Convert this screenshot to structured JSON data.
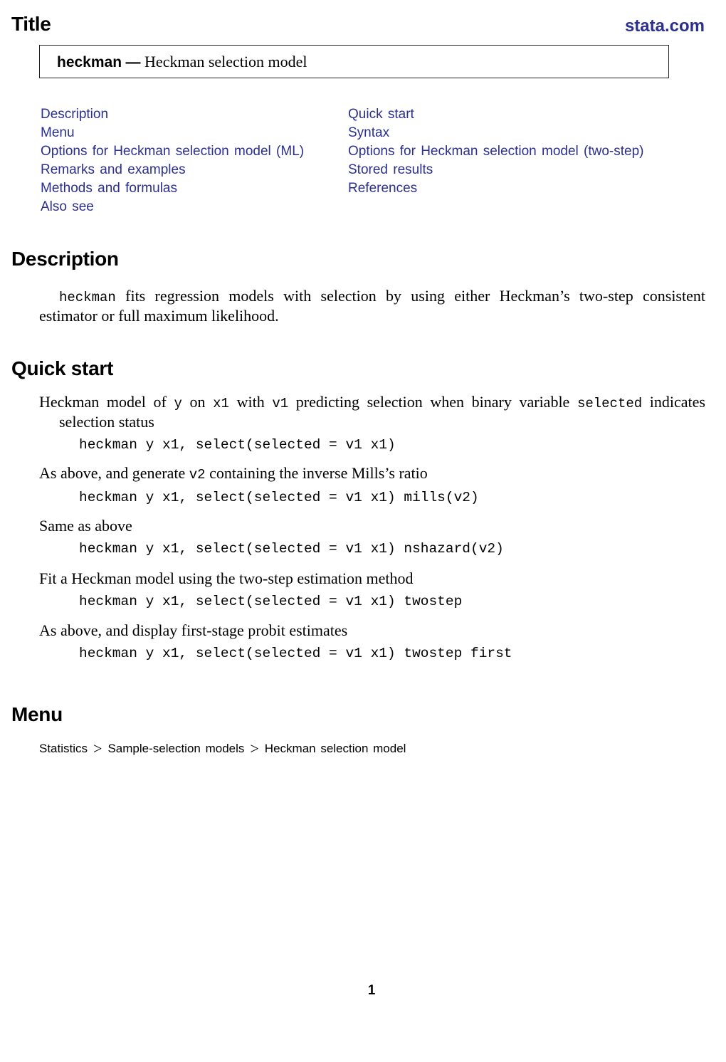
{
  "header": {
    "section_title": "Title",
    "brand_link": "stata.com"
  },
  "title_box": {
    "command": "heckman",
    "dash": "—",
    "description": "Heckman selection model"
  },
  "toc": {
    "left": [
      "Description",
      "Menu",
      "Options for Heckman selection model (ML)",
      "Remarks and examples",
      "Methods and formulas",
      "Also see"
    ],
    "right": [
      "Quick start",
      "Syntax",
      "Options for Heckman selection model (two-step)",
      "Stored results",
      "References"
    ]
  },
  "description": {
    "heading": "Description",
    "command": "heckman",
    "text": " fits regression models with selection by using either Heckman’s two-step consistent estimator or full maximum likelihood."
  },
  "quick_start": {
    "heading": "Quick start",
    "items": [
      {
        "desc_parts": [
          {
            "t": "Heckman model of ",
            "m": false
          },
          {
            "t": "y",
            "m": true
          },
          {
            "t": " on ",
            "m": false
          },
          {
            "t": "x1",
            "m": true
          },
          {
            "t": " with ",
            "m": false
          },
          {
            "t": "v1",
            "m": true
          },
          {
            "t": " predicting selection when binary variable ",
            "m": false
          },
          {
            "t": "selected",
            "m": true
          },
          {
            "t": " indicates selection status",
            "m": false
          }
        ],
        "command": "heckman y x1, select(selected = v1 x1)"
      },
      {
        "desc_parts": [
          {
            "t": "As above, and generate ",
            "m": false
          },
          {
            "t": "v2",
            "m": true
          },
          {
            "t": " containing the inverse Mills’s ratio",
            "m": false
          }
        ],
        "command": "heckman y x1, select(selected = v1 x1) mills(v2)"
      },
      {
        "desc_parts": [
          {
            "t": "Same as above",
            "m": false
          }
        ],
        "command": "heckman y x1, select(selected = v1 x1) nshazard(v2)"
      },
      {
        "desc_parts": [
          {
            "t": "Fit a Heckman model using the two-step estimation method",
            "m": false
          }
        ],
        "command": "heckman y x1, select(selected = v1 x1) twostep"
      },
      {
        "desc_parts": [
          {
            "t": "As above, and display first-stage probit estimates",
            "m": false
          }
        ],
        "command": "heckman y x1, select(selected = v1 x1) twostep first"
      }
    ]
  },
  "menu": {
    "heading": "Menu",
    "path": [
      "Statistics",
      "Sample-selection models",
      "Heckman selection model"
    ],
    "separator": ">"
  },
  "footer": {
    "page_number": "1"
  },
  "colors": {
    "link": "#2b2f8f",
    "text": "#000000"
  }
}
